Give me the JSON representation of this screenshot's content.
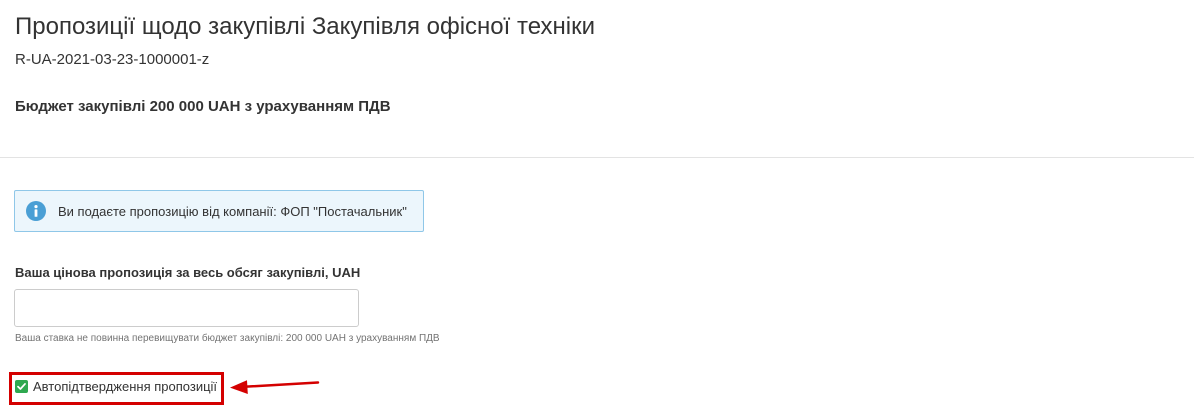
{
  "header": {
    "title": "Пропозиції щодо закупівлі Закупівля офісної техніки",
    "tender_id": "R-UA-2021-03-23-1000001-z",
    "budget": "Бюджет закупівлі 200 000 UAH з урахуванням ПДВ"
  },
  "info_alert": {
    "icon": "info-icon",
    "text": "Ви подаєте пропозицію від компанії: ФОП \"Постачальник\""
  },
  "price_field": {
    "label": "Ваша цінова пропозиція за весь обсяг закупівлі, UAH",
    "value": "",
    "placeholder": "",
    "hint": "Ваша ставка не повинна перевищувати бюджет закупівлі: 200 000 UAH з урахуванням ПДВ"
  },
  "auto_confirm": {
    "label": "Автопідтвердження пропозиції",
    "checked": true
  },
  "colors": {
    "alert_bg": "#ecf6fc",
    "alert_border": "#8fc7e8",
    "info_icon": "#4a9fd5",
    "checkbox": "#2ea84f",
    "annotation": "#d40000"
  }
}
